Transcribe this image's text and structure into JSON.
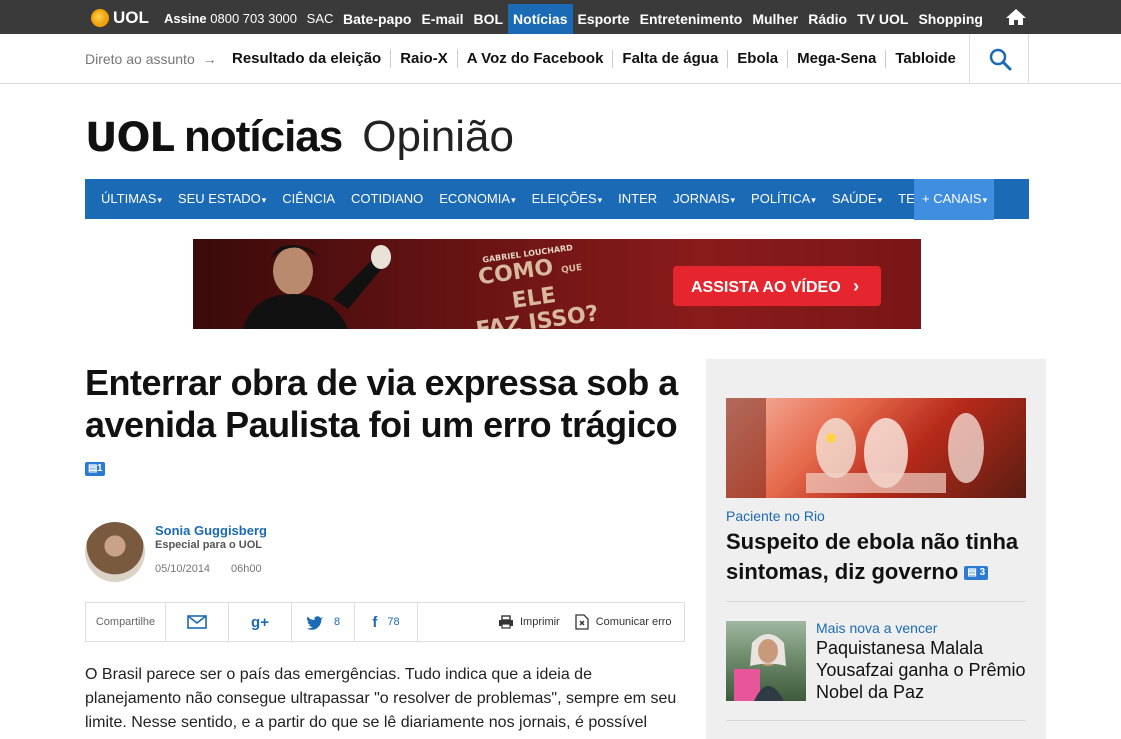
{
  "topbar": {
    "brand": "UOL",
    "assine_label": "Assine",
    "phone": "0800 703 3000",
    "sac": "SAC",
    "nav": [
      "Bate-papo",
      "E-mail",
      "BOL",
      "Notícias",
      "Esporte",
      "Entretenimento",
      "Mulher",
      "Rádio",
      "TV UOL",
      "Shopping"
    ],
    "active_index": 3
  },
  "subbar": {
    "direto": "Direto ao assunto",
    "links": [
      "Resultado da eleição",
      "Raio-X",
      "A Voz do Facebook",
      "Falta de água",
      "Ebola",
      "Mega-Sena",
      "Tabloide"
    ]
  },
  "brand": {
    "uol": "UOL",
    "noticias": "notícias",
    "section": "Opinião"
  },
  "mainnav": {
    "items": [
      "ÚLTIMAS",
      "SEU ESTADO",
      "CIÊNCIA",
      "COTIDIANO",
      "ECONOMIA",
      "ELEIÇÕES",
      "INTER",
      "JORNAIS",
      "POLÍTICA",
      "SAÚDE",
      "TEC"
    ],
    "dropdown": [
      true,
      true,
      false,
      false,
      true,
      true,
      false,
      true,
      true,
      true,
      true
    ],
    "canais": "+ CANAIS"
  },
  "banner": {
    "author": "GABRIEL LOUCHARD",
    "line1": "COMO",
    "que": "QUE",
    "ele": "ELE",
    "line2": "FAZ ISSO?",
    "cta": "ASSISTA AO VÍDEO"
  },
  "article": {
    "headline": "Enterrar obra de via expressa sob a avenida Paulista foi um erro trágico",
    "comment_count": "1",
    "author": "Sonia Guggisberg",
    "role": "Especial para o UOL",
    "date": "05/10/2014",
    "time": "06h00",
    "share_label": "Compartilhe",
    "twitter_count": "8",
    "facebook_count": "78",
    "print_label": "Imprimir",
    "report_label": "Comunicar erro",
    "body": "O Brasil parece ser o país das emergências. Tudo indica que a ideia de planejamento não consegue ultrapassar \"o resolver de problemas\", sempre em seu limite. Nesse sentido, e a partir do que se lê diariamente nos jornais, é possível"
  },
  "sidebar": {
    "kicker1": "Paciente no Rio",
    "title1": "Suspeito de ebola não tinha sintomas, diz governo",
    "count1": "3",
    "kicker2": "Mais nova a vencer",
    "title2": "Paquistanesa Malala Yousafzai ganha o Prêmio Nobel da Paz"
  },
  "colors": {
    "topbar": "#3a3a3a",
    "brand_blue": "#1b6ab5",
    "canais": "#3f8ee0",
    "cta_red": "#e5262e"
  }
}
